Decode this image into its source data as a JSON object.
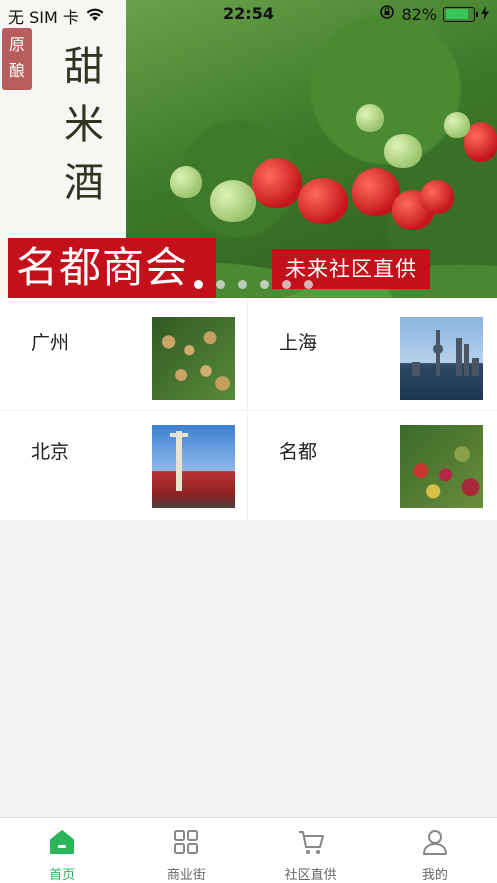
{
  "status_bar": {
    "carrier": "无 SIM 卡",
    "time": "22:54",
    "battery_percent": "82%",
    "battery_level": 0.82
  },
  "banner": {
    "seal_text": "原酿",
    "vertical_title": "甜米酒",
    "main_tag": "名都商会",
    "sub_tag": "未来社区直供",
    "page_count": 6,
    "active_page": 0
  },
  "cities": [
    {
      "name": "广州",
      "image": "longan-fruit"
    },
    {
      "name": "上海",
      "image": "shanghai-skyline"
    },
    {
      "name": "北京",
      "image": "tiananmen"
    },
    {
      "name": "名都",
      "image": "grapes"
    }
  ],
  "tabbar": {
    "items": [
      {
        "label": "首页",
        "icon": "home-icon",
        "active": true
      },
      {
        "label": "商业街",
        "icon": "grid-icon",
        "active": false
      },
      {
        "label": "社区直供",
        "icon": "cart-icon",
        "active": false
      },
      {
        "label": "我的",
        "icon": "user-icon",
        "active": false
      }
    ],
    "active_color": "#2bb55b",
    "inactive_color": "#666666"
  },
  "colors": {
    "brand_red": "#c3101a",
    "background": "#f3f3f3"
  }
}
